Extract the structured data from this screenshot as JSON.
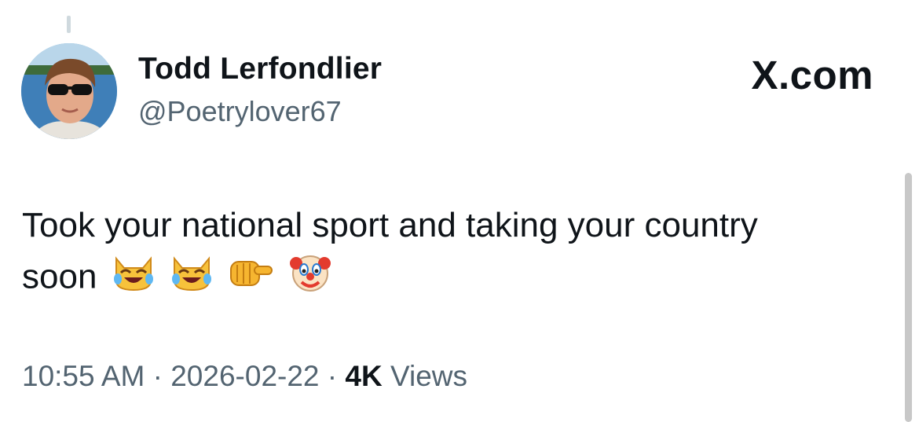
{
  "author": {
    "display_name": "Todd Lerfondlier",
    "handle": "@Poetrylover67"
  },
  "brand_label": "X.com",
  "tweet": {
    "line1": "Took your national sport and taking your country",
    "line2": "soon",
    "emojis": [
      "crying-laughing-cat-icon",
      "crying-laughing-cat-icon",
      "pointing-fist-icon",
      "clown-face-icon"
    ]
  },
  "meta": {
    "time": "10:55 AM",
    "separator": "·",
    "date": "2026-02-22",
    "views_count": "4K",
    "views_label": "Views"
  },
  "colors": {
    "text": "#0f1419",
    "secondary_text": "#536471",
    "thread_line": "#cfd9de",
    "background": "#ffffff"
  }
}
